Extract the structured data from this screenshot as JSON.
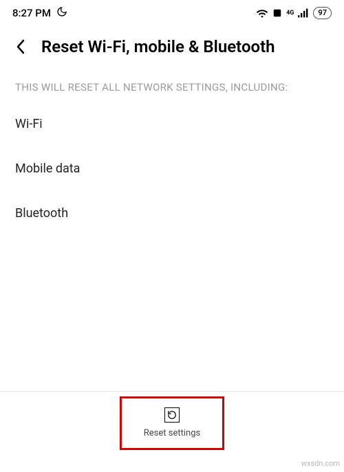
{
  "status_bar": {
    "time": "8:27 PM",
    "battery": "97",
    "network_label": "4G"
  },
  "header": {
    "title": "Reset Wi-Fi, mobile & Bluetooth"
  },
  "subtitle": "THIS WILL RESET ALL NETWORK SETTINGS, INCLUDING:",
  "items": [
    "Wi-Fi",
    "Mobile data",
    "Bluetooth"
  ],
  "reset_button": {
    "label": "Reset settings"
  },
  "watermark": "wxsdn.com"
}
